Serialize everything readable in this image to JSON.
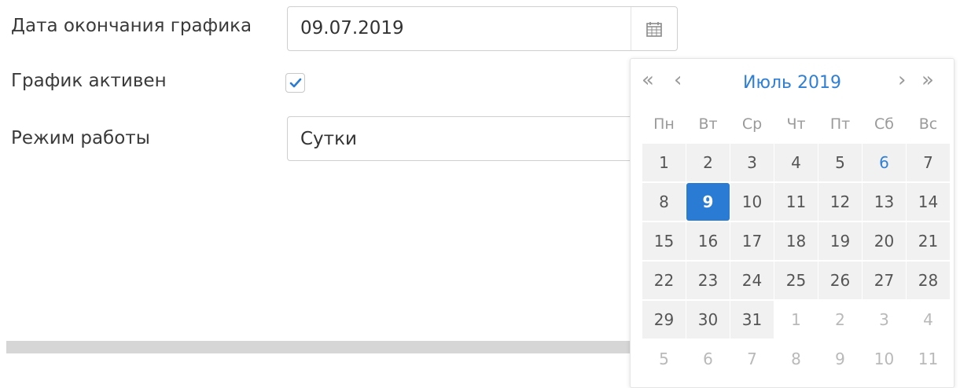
{
  "form": {
    "end_date_label": "Дата окончания графика",
    "end_date_value": "09.07.2019",
    "active_label": "График активен",
    "active_checked": true,
    "mode_label": "Режим работы",
    "mode_value": "Сутки"
  },
  "icons": {
    "calendar": "calendar-icon",
    "checkmark": "checkmark-icon"
  },
  "datepicker": {
    "nav_prev_year": "«",
    "nav_prev_month": "‹",
    "month_title": "Июль 2019",
    "nav_next_month": "›",
    "nav_next_year": "»",
    "weekdays": [
      "Пн",
      "Вт",
      "Ср",
      "Чт",
      "Пт",
      "Сб",
      "Вс"
    ],
    "days": [
      {
        "label": "1",
        "state": "current"
      },
      {
        "label": "2",
        "state": "current"
      },
      {
        "label": "3",
        "state": "current"
      },
      {
        "label": "4",
        "state": "current"
      },
      {
        "label": "5",
        "state": "current"
      },
      {
        "label": "6",
        "state": "highlight"
      },
      {
        "label": "7",
        "state": "current"
      },
      {
        "label": "8",
        "state": "current"
      },
      {
        "label": "9",
        "state": "selected"
      },
      {
        "label": "10",
        "state": "current"
      },
      {
        "label": "11",
        "state": "current"
      },
      {
        "label": "12",
        "state": "current"
      },
      {
        "label": "13",
        "state": "current"
      },
      {
        "label": "14",
        "state": "current"
      },
      {
        "label": "15",
        "state": "current"
      },
      {
        "label": "16",
        "state": "current"
      },
      {
        "label": "17",
        "state": "current"
      },
      {
        "label": "18",
        "state": "current"
      },
      {
        "label": "19",
        "state": "current"
      },
      {
        "label": "20",
        "state": "current"
      },
      {
        "label": "21",
        "state": "current"
      },
      {
        "label": "22",
        "state": "current"
      },
      {
        "label": "23",
        "state": "current"
      },
      {
        "label": "24",
        "state": "current"
      },
      {
        "label": "25",
        "state": "current"
      },
      {
        "label": "26",
        "state": "current"
      },
      {
        "label": "27",
        "state": "current"
      },
      {
        "label": "28",
        "state": "current"
      },
      {
        "label": "29",
        "state": "current"
      },
      {
        "label": "30",
        "state": "current"
      },
      {
        "label": "31",
        "state": "current"
      },
      {
        "label": "1",
        "state": "other"
      },
      {
        "label": "2",
        "state": "other"
      },
      {
        "label": "3",
        "state": "other"
      },
      {
        "label": "4",
        "state": "other"
      },
      {
        "label": "5",
        "state": "other"
      },
      {
        "label": "6",
        "state": "other"
      },
      {
        "label": "7",
        "state": "other"
      },
      {
        "label": "8",
        "state": "other"
      },
      {
        "label": "9",
        "state": "other"
      },
      {
        "label": "10",
        "state": "other"
      },
      {
        "label": "11",
        "state": "other"
      }
    ]
  },
  "colors": {
    "accent": "#2a7bd3",
    "link": "#2f7fd6",
    "day_bg": "#f1f1f1",
    "muted": "#b9b9b9"
  }
}
